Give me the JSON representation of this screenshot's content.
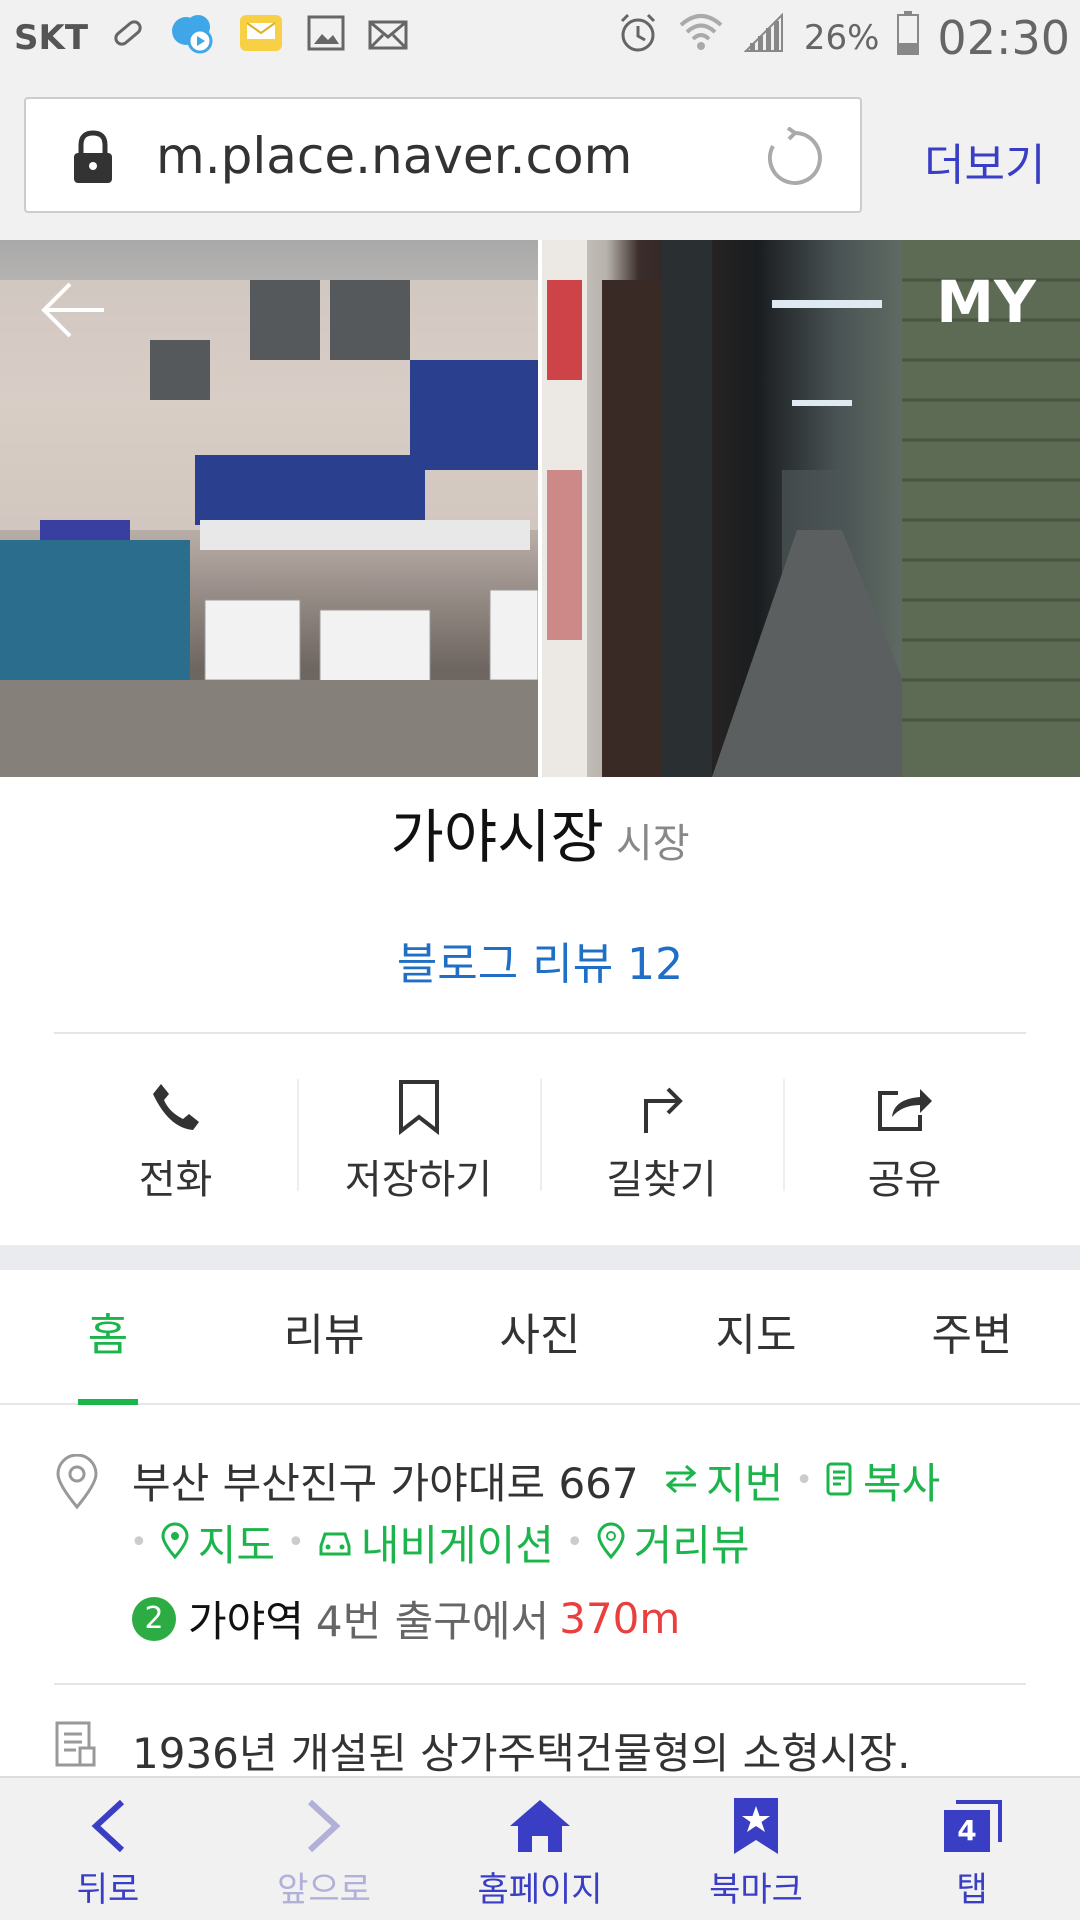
{
  "status_bar": {
    "carrier": "SKT",
    "battery_percent": "26%",
    "time": "02:30",
    "icons": [
      "pill-icon",
      "cloud-play-icon",
      "message-icon",
      "image-icon",
      "mail-icon",
      "alarm-icon",
      "wifi-icon",
      "signal-icon",
      "battery-icon"
    ]
  },
  "browser": {
    "url": "m.place.naver.com",
    "more_label": "더보기"
  },
  "header_overlay": {
    "my_label": "MY"
  },
  "place": {
    "name": "가야시장",
    "category": "시장",
    "blog_review": "블로그 리뷰 12"
  },
  "actions": [
    {
      "label": "전화",
      "icon": "phone-icon"
    },
    {
      "label": "저장하기",
      "icon": "bookmark-icon"
    },
    {
      "label": "길찾기",
      "icon": "directions-icon"
    },
    {
      "label": "공유",
      "icon": "share-icon"
    }
  ],
  "tabs": [
    {
      "label": "홈",
      "active": true
    },
    {
      "label": "리뷰",
      "active": false
    },
    {
      "label": "사진",
      "active": false
    },
    {
      "label": "지도",
      "active": false
    },
    {
      "label": "주변",
      "active": false
    }
  ],
  "info": {
    "address": "부산 부산진구 가야대로 667",
    "links": {
      "lot_number": "지번",
      "copy": "복사",
      "map": "지도",
      "navigation": "내비게이션",
      "street_view": "거리뷰"
    },
    "subway": {
      "line": "2",
      "station": "가야역",
      "exit": "4번 출구에서",
      "distance": "370m"
    },
    "description": "1936년 개설된 상가주택건물형의 소형시장."
  },
  "colors": {
    "accent_green": "#1cb54b",
    "link_blue": "#1f6fc5",
    "nav_purple": "#3a3ec4",
    "distance_red": "#ea3f3f"
  },
  "bottom_nav": [
    {
      "label": "뒤로",
      "icon": "back-icon",
      "enabled": true
    },
    {
      "label": "앞으로",
      "icon": "forward-icon",
      "enabled": false
    },
    {
      "label": "홈페이지",
      "icon": "home-icon",
      "enabled": true
    },
    {
      "label": "북마크",
      "icon": "bookmark-star-icon",
      "enabled": true
    },
    {
      "label": "탭",
      "icon": "tabs-icon",
      "enabled": true,
      "count": "4"
    }
  ]
}
